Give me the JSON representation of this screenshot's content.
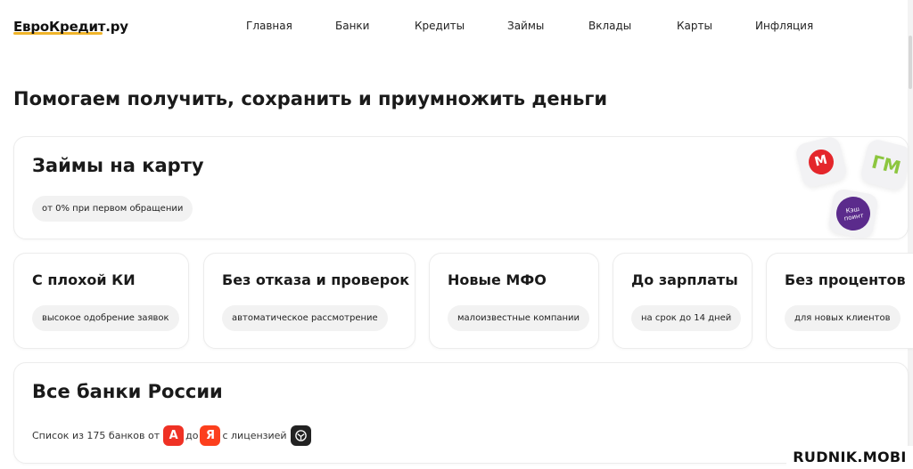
{
  "header": {
    "logo": "ЕвроКредит.ру",
    "nav": [
      "Главная",
      "Банки",
      "Кредиты",
      "Займы",
      "Вклады",
      "Карты",
      "Инфляция"
    ]
  },
  "headline": "Помогаем получить, сохранить и приумножить деньги",
  "loans_card": {
    "title": "Займы на карту",
    "pill": "от 0% при первом обращении",
    "logo_texts": [
      "М",
      "ГМ",
      "Кэш поинт"
    ]
  },
  "categories": [
    {
      "title": "С плохой КИ",
      "pill": "высокое одобрение заявок"
    },
    {
      "title": "Без отказа и проверок",
      "pill": "автоматическое рассмотрение"
    },
    {
      "title": "Новые МФО",
      "pill": "малоизвестные компании"
    },
    {
      "title": "До зарплаты",
      "pill": "на срок до 14 дней"
    },
    {
      "title": "Без процентов",
      "pill": "для новых клиентов"
    }
  ],
  "banks_card": {
    "title": "Все банки России",
    "text_before": "Список из 175 банков от",
    "text_mid": "до",
    "text_after": "с лицензией",
    "badge_a": "А",
    "badge_ya": "Я"
  },
  "watermark": "RUDNIK.MOBI",
  "colors": {
    "accent_yellow": "#f0b429",
    "alfa_red": "#ef3124",
    "yandex_red": "#fc3f1d",
    "cbr_dark": "#222222",
    "moneyman_red": "#e4262b",
    "gm_green": "#8cc63f",
    "gm_pink": "#e6007e",
    "cashpoint_purple": "#5b2b8c"
  }
}
